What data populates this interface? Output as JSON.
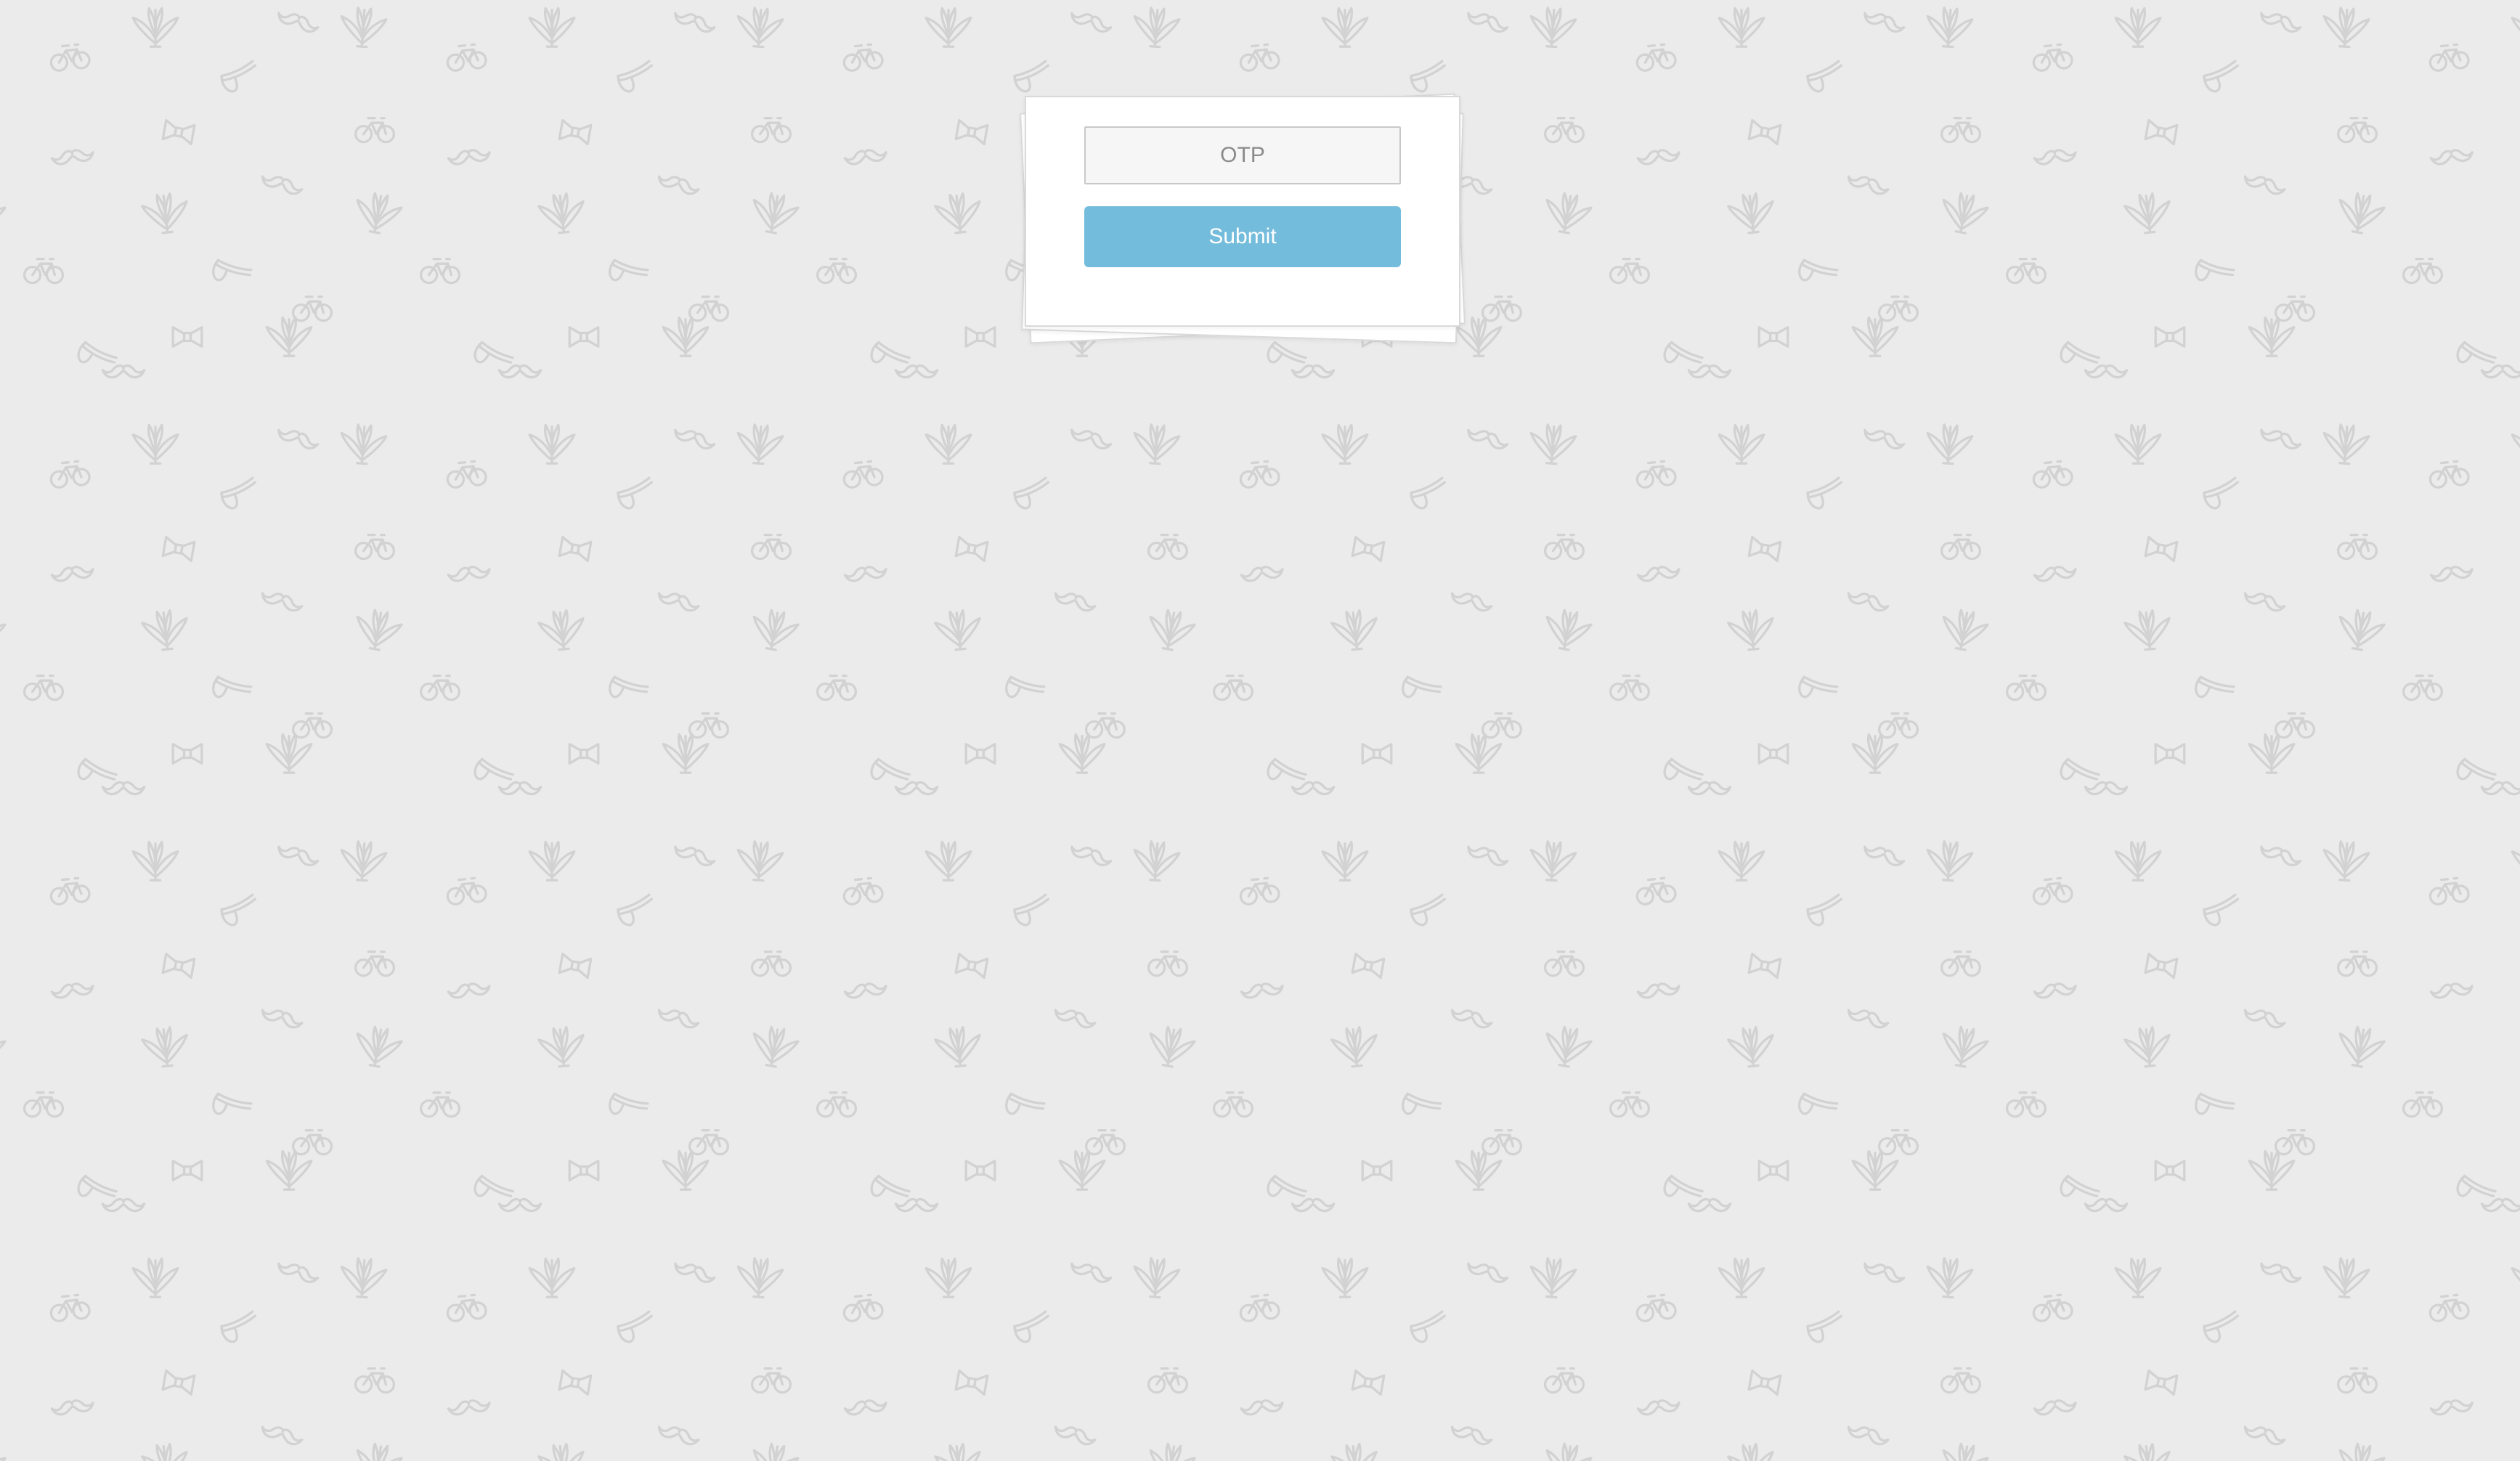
{
  "form": {
    "otp_placeholder": "OTP",
    "otp_value": "",
    "submit_label": "Submit"
  },
  "colors": {
    "page_background": "#ebebeb",
    "pattern_stroke": "#d2d2d2",
    "card_background": "#ffffff",
    "submit_button": "#74bcdb"
  },
  "background_pattern": {
    "icons": [
      "bicycle-icon",
      "leaf-icon",
      "bowtie-icon",
      "mustache-icon",
      "pipe-icon"
    ]
  }
}
